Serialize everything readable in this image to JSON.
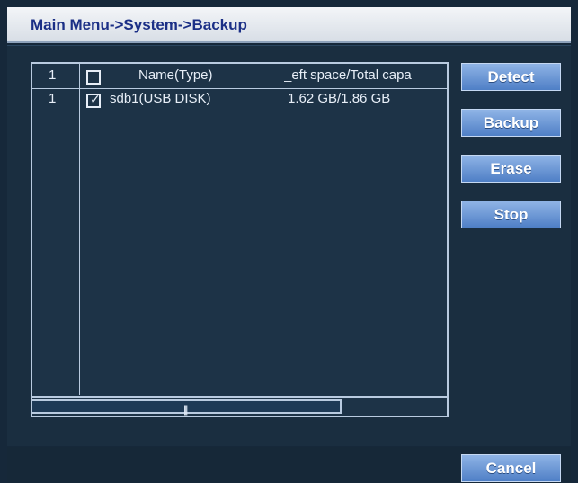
{
  "window": {
    "title": "Main Menu->System->Backup"
  },
  "table": {
    "header": {
      "index": "1",
      "name": "Name(Type)",
      "space": "_eft space/Total capa"
    },
    "rows": [
      {
        "index": "1",
        "checked": true,
        "name": "sdb1(USB DISK)",
        "space": "1.62 GB/1.86 GB"
      }
    ],
    "scroll_grip": "|||"
  },
  "buttons": {
    "detect": "Detect",
    "backup": "Backup",
    "erase": "Erase",
    "stop": "Stop",
    "cancel": "Cancel"
  }
}
